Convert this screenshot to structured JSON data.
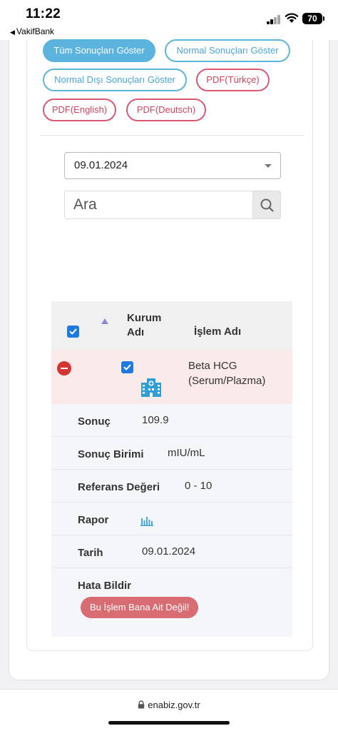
{
  "status_bar": {
    "time": "11:22",
    "back_app": "VakifBank",
    "battery": "70"
  },
  "filters": {
    "all": "Tüm Sonuçları Göster",
    "normal": "Normal Sonuçları Göster",
    "abnormal": "Normal Dışı Sonuçları Göster",
    "pdf_tr": "PDF(Türkçe)",
    "pdf_en": "PDF(English)",
    "pdf_de": "PDF(Deutsch)"
  },
  "date_select": {
    "value": "09.01.2024"
  },
  "search": {
    "placeholder": "Ara"
  },
  "table": {
    "headers": {
      "institution": "Kurum Adı",
      "procedure": "İşlem Adı"
    },
    "row": {
      "procedure": "Beta HCG (Serum/Plazma)",
      "details": [
        {
          "label": "Sonuç",
          "value": "109.9"
        },
        {
          "label": "Sonuç Birimi",
          "value": "mIU/mL"
        },
        {
          "label": "Referans Değeri",
          "value": "0 - 10"
        },
        {
          "label": "Rapor",
          "value": ""
        },
        {
          "label": "Tarih",
          "value": "09.01.2024"
        },
        {
          "label": "Hata Bildir",
          "value": ""
        }
      ],
      "report_button": "Bu İşlem Bana Ait Değil!"
    }
  },
  "browser": {
    "url": "enabiz.gov.tr"
  },
  "colors": {
    "accent_blue": "#5bb4de",
    "accent_red": "#d85a72",
    "highlight_row": "#fbeaea",
    "danger": "#d33434"
  },
  "icons": [
    "signal-icon",
    "wifi-icon",
    "battery-icon",
    "search-icon",
    "sort-arrow-icon",
    "remove-row-icon",
    "hospital-icon",
    "chart-report-icon",
    "lock-icon"
  ]
}
